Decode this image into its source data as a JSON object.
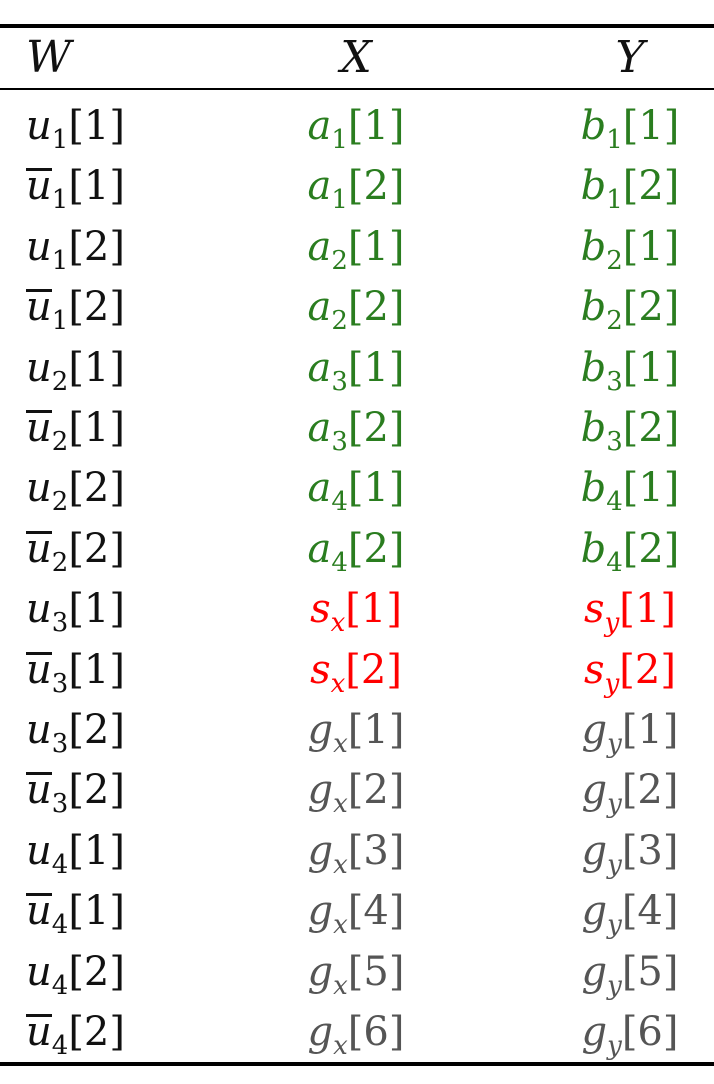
{
  "headers": [
    "W",
    "X",
    "Y"
  ],
  "colors": {
    "black": "#111111",
    "green": "#2a7d1f",
    "red": "#ff0000",
    "gray": "#555555"
  },
  "rows": [
    {
      "w": {
        "base": "u",
        "sub": "1",
        "idx": "1",
        "bar": false
      },
      "x": {
        "base": "a",
        "sub": "1",
        "idx": "1",
        "color": "green"
      },
      "y": {
        "base": "b",
        "sub": "1",
        "idx": "1",
        "color": "green"
      }
    },
    {
      "w": {
        "base": "u",
        "sub": "1",
        "idx": "1",
        "bar": true
      },
      "x": {
        "base": "a",
        "sub": "1",
        "idx": "2",
        "color": "green"
      },
      "y": {
        "base": "b",
        "sub": "1",
        "idx": "2",
        "color": "green"
      }
    },
    {
      "w": {
        "base": "u",
        "sub": "1",
        "idx": "2",
        "bar": false
      },
      "x": {
        "base": "a",
        "sub": "2",
        "idx": "1",
        "color": "green"
      },
      "y": {
        "base": "b",
        "sub": "2",
        "idx": "1",
        "color": "green"
      }
    },
    {
      "w": {
        "base": "u",
        "sub": "1",
        "idx": "2",
        "bar": true
      },
      "x": {
        "base": "a",
        "sub": "2",
        "idx": "2",
        "color": "green"
      },
      "y": {
        "base": "b",
        "sub": "2",
        "idx": "2",
        "color": "green"
      }
    },
    {
      "w": {
        "base": "u",
        "sub": "2",
        "idx": "1",
        "bar": false
      },
      "x": {
        "base": "a",
        "sub": "3",
        "idx": "1",
        "color": "green"
      },
      "y": {
        "base": "b",
        "sub": "3",
        "idx": "1",
        "color": "green"
      }
    },
    {
      "w": {
        "base": "u",
        "sub": "2",
        "idx": "1",
        "bar": true
      },
      "x": {
        "base": "a",
        "sub": "3",
        "idx": "2",
        "color": "green"
      },
      "y": {
        "base": "b",
        "sub": "3",
        "idx": "2",
        "color": "green"
      }
    },
    {
      "w": {
        "base": "u",
        "sub": "2",
        "idx": "2",
        "bar": false
      },
      "x": {
        "base": "a",
        "sub": "4",
        "idx": "1",
        "color": "green"
      },
      "y": {
        "base": "b",
        "sub": "4",
        "idx": "1",
        "color": "green"
      }
    },
    {
      "w": {
        "base": "u",
        "sub": "2",
        "idx": "2",
        "bar": true
      },
      "x": {
        "base": "a",
        "sub": "4",
        "idx": "2",
        "color": "green"
      },
      "y": {
        "base": "b",
        "sub": "4",
        "idx": "2",
        "color": "green"
      }
    },
    {
      "w": {
        "base": "u",
        "sub": "3",
        "idx": "1",
        "bar": false
      },
      "x": {
        "base": "s",
        "sub": "x",
        "idx": "1",
        "color": "red"
      },
      "y": {
        "base": "s",
        "sub": "y",
        "idx": "1",
        "color": "red"
      }
    },
    {
      "w": {
        "base": "u",
        "sub": "3",
        "idx": "1",
        "bar": true
      },
      "x": {
        "base": "s",
        "sub": "x",
        "idx": "2",
        "color": "red"
      },
      "y": {
        "base": "s",
        "sub": "y",
        "idx": "2",
        "color": "red"
      }
    },
    {
      "w": {
        "base": "u",
        "sub": "3",
        "idx": "2",
        "bar": false
      },
      "x": {
        "base": "g",
        "sub": "x",
        "idx": "1",
        "color": "gray"
      },
      "y": {
        "base": "g",
        "sub": "y",
        "idx": "1",
        "color": "gray"
      }
    },
    {
      "w": {
        "base": "u",
        "sub": "3",
        "idx": "2",
        "bar": true
      },
      "x": {
        "base": "g",
        "sub": "x",
        "idx": "2",
        "color": "gray"
      },
      "y": {
        "base": "g",
        "sub": "y",
        "idx": "2",
        "color": "gray"
      }
    },
    {
      "w": {
        "base": "u",
        "sub": "4",
        "idx": "1",
        "bar": false
      },
      "x": {
        "base": "g",
        "sub": "x",
        "idx": "3",
        "color": "gray"
      },
      "y": {
        "base": "g",
        "sub": "y",
        "idx": "3",
        "color": "gray"
      }
    },
    {
      "w": {
        "base": "u",
        "sub": "4",
        "idx": "1",
        "bar": true
      },
      "x": {
        "base": "g",
        "sub": "x",
        "idx": "4",
        "color": "gray"
      },
      "y": {
        "base": "g",
        "sub": "y",
        "idx": "4",
        "color": "gray"
      }
    },
    {
      "w": {
        "base": "u",
        "sub": "4",
        "idx": "2",
        "bar": false
      },
      "x": {
        "base": "g",
        "sub": "x",
        "idx": "5",
        "color": "gray"
      },
      "y": {
        "base": "g",
        "sub": "y",
        "idx": "5",
        "color": "gray"
      }
    },
    {
      "w": {
        "base": "u",
        "sub": "4",
        "idx": "2",
        "bar": true
      },
      "x": {
        "base": "g",
        "sub": "x",
        "idx": "6",
        "color": "gray"
      },
      "y": {
        "base": "g",
        "sub": "y",
        "idx": "6",
        "color": "gray"
      }
    }
  ]
}
